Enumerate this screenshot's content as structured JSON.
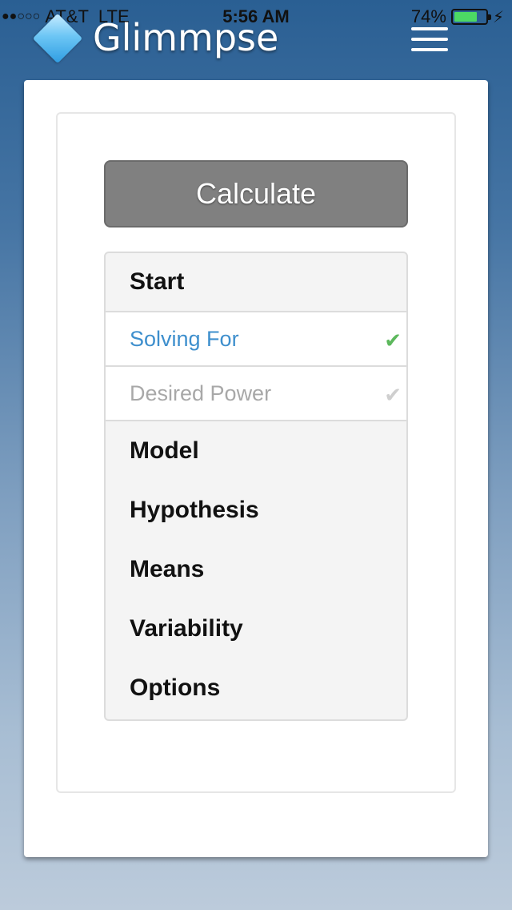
{
  "status_bar": {
    "carrier": "AT&T",
    "network": "LTE",
    "time": "5:56 AM",
    "battery_percent": "74%",
    "battery_level": 0.74,
    "signal_dots": "●●○○○"
  },
  "header": {
    "title": "Glimmpse"
  },
  "main": {
    "calculate_label": "Calculate",
    "nav": {
      "start": "Start",
      "solving_for": "Solving For",
      "desired_power": "Desired Power",
      "model": "Model",
      "hypothesis": "Hypothesis",
      "means": "Means",
      "variability": "Variability",
      "options": "Options"
    }
  },
  "colors": {
    "active_link": "#3e8fcd",
    "check_complete": "#5cb85c",
    "check_incomplete": "#cfcfcf",
    "button_gray": "#808080"
  },
  "icons": {
    "check": "✔",
    "bolt": "⚡"
  }
}
